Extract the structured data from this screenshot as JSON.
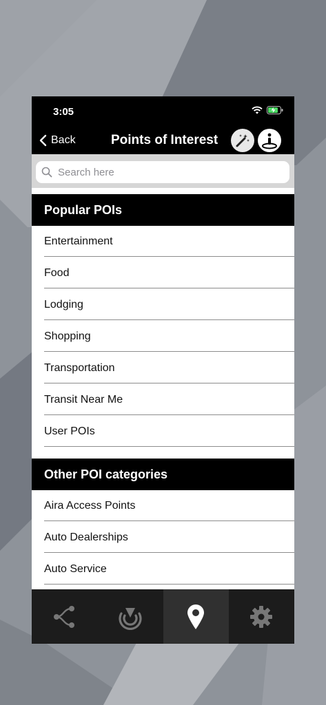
{
  "status": {
    "time": "3:05"
  },
  "nav": {
    "back_label": "Back",
    "title": "Points of Interest"
  },
  "search": {
    "placeholder": "Search here",
    "value": ""
  },
  "sections": [
    {
      "header": "Popular POIs",
      "items": [
        "Entertainment",
        "Food",
        "Lodging",
        "Shopping",
        "Transportation",
        "Transit Near Me",
        "User POIs"
      ]
    },
    {
      "header": "Other POI categories",
      "items": [
        "Aira Access Points",
        "Auto Dealerships",
        "Auto Service"
      ]
    }
  ],
  "tabs": [
    {
      "icon": "route-icon",
      "active": false
    },
    {
      "icon": "radar-icon",
      "active": false
    },
    {
      "icon": "location-pin-icon",
      "active": true
    },
    {
      "icon": "gear-icon",
      "active": false
    }
  ],
  "colors": {
    "bar": "#000000",
    "tabbar": "#1c1c1c",
    "active_tab": "#303030",
    "battery": "#4cd964"
  }
}
